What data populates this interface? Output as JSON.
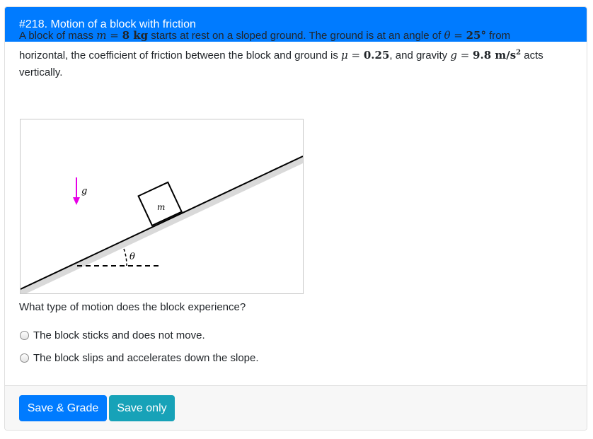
{
  "header": {
    "title": "#218. Motion of a block with friction"
  },
  "problem": {
    "line1_a": "A block of mass ",
    "mass_var": "m",
    "mass_eq": " = ",
    "mass_val": "8 kg",
    "line1_b": " starts at rest on a sloped ground. The ground is at an angle of ",
    "theta_var": "θ",
    "theta_eq": " = ",
    "theta_val": "25°",
    "line1_c": " from",
    "line2_a": "horizontal, the coefficient of friction between the block and ground is ",
    "mu_var": "μ",
    "mu_eq": " = ",
    "mu_val": "0.25",
    "line2_b": ", and gravity ",
    "g_var": "g",
    "g_eq": " = ",
    "g_val": "9.8 m/s",
    "g_exp": "2",
    "line2_c": " acts",
    "line3": "vertically."
  },
  "figure": {
    "gravity_label": "g",
    "mass_label": "m",
    "angle_label": "θ",
    "colors": {
      "gravity_arrow": "#e600e6",
      "slope_shadow": "#d9d9d9",
      "line": "#000000"
    }
  },
  "question": "What type of motion does the block experience?",
  "options": [
    {
      "label": "The block sticks and does not move.",
      "selected": false
    },
    {
      "label": "The block slips and accelerates down the slope.",
      "selected": false
    }
  ],
  "footer": {
    "save_grade_label": "Save & Grade",
    "save_only_label": "Save only"
  },
  "colors": {
    "primary": "#007bff",
    "info": "#17a2b8"
  }
}
